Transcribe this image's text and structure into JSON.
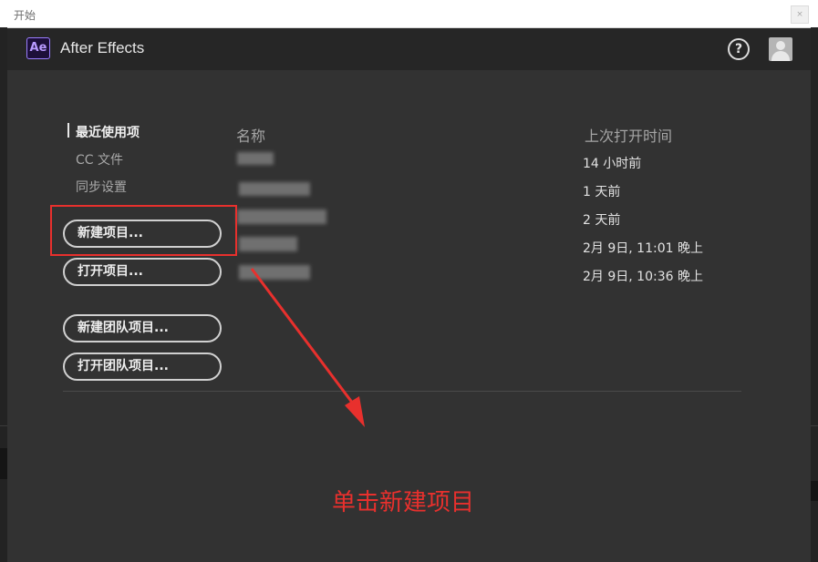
{
  "window": {
    "title": "开始",
    "close_label": "×"
  },
  "header": {
    "logo_text": "Ae",
    "app_name": "After Effects",
    "help_label": "?"
  },
  "nav": {
    "items": [
      {
        "label": "最近使用项",
        "active": true
      },
      {
        "label": "CC 文件",
        "active": false
      },
      {
        "label": "同步设置",
        "active": false
      }
    ]
  },
  "buttons": {
    "new_project": "新建项目...",
    "open_project": "打开项目...",
    "new_team_project": "新建团队项目...",
    "open_team_project": "打开团队项目..."
  },
  "recent": {
    "name_header": "名称",
    "time_header": "上次打开时间",
    "times": [
      "14 小时前",
      "1 天前",
      "2 天前",
      "2月 9日, 11:01 晚上",
      "2月 9日, 10:36 晚上"
    ]
  },
  "annotation": {
    "caption": "单击新建项目",
    "color": "#e8302d"
  },
  "colors": {
    "accent_logo": "#9a7dff",
    "dialog_bg": "#323232",
    "header_bg": "#262626"
  }
}
